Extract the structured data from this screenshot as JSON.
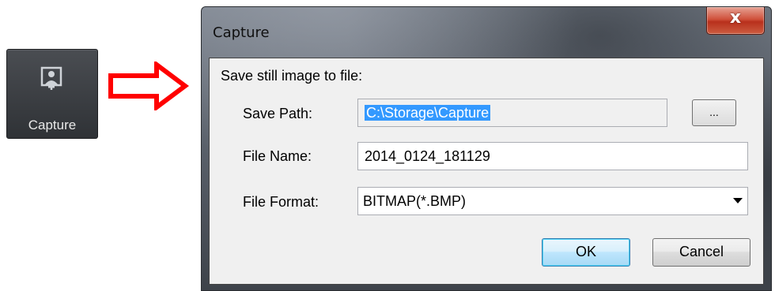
{
  "toolbar_button": {
    "label": "Capture",
    "icon": "capture-icon"
  },
  "arrow": {
    "color": "#ff0000",
    "icon": "right-arrow-icon"
  },
  "dialog": {
    "title": "Capture",
    "close_glyph": "x",
    "prompt": "Save still image to file:",
    "save_path": {
      "label": "Save Path:",
      "value": "C:\\Storage\\Capture",
      "browse_label": "..."
    },
    "file_name": {
      "label": "File Name:",
      "value": "2014_0124_181129"
    },
    "file_format": {
      "label": "File Format:",
      "selected": "BITMAP(*.BMP)"
    },
    "ok_label": "OK",
    "cancel_label": "Cancel"
  }
}
